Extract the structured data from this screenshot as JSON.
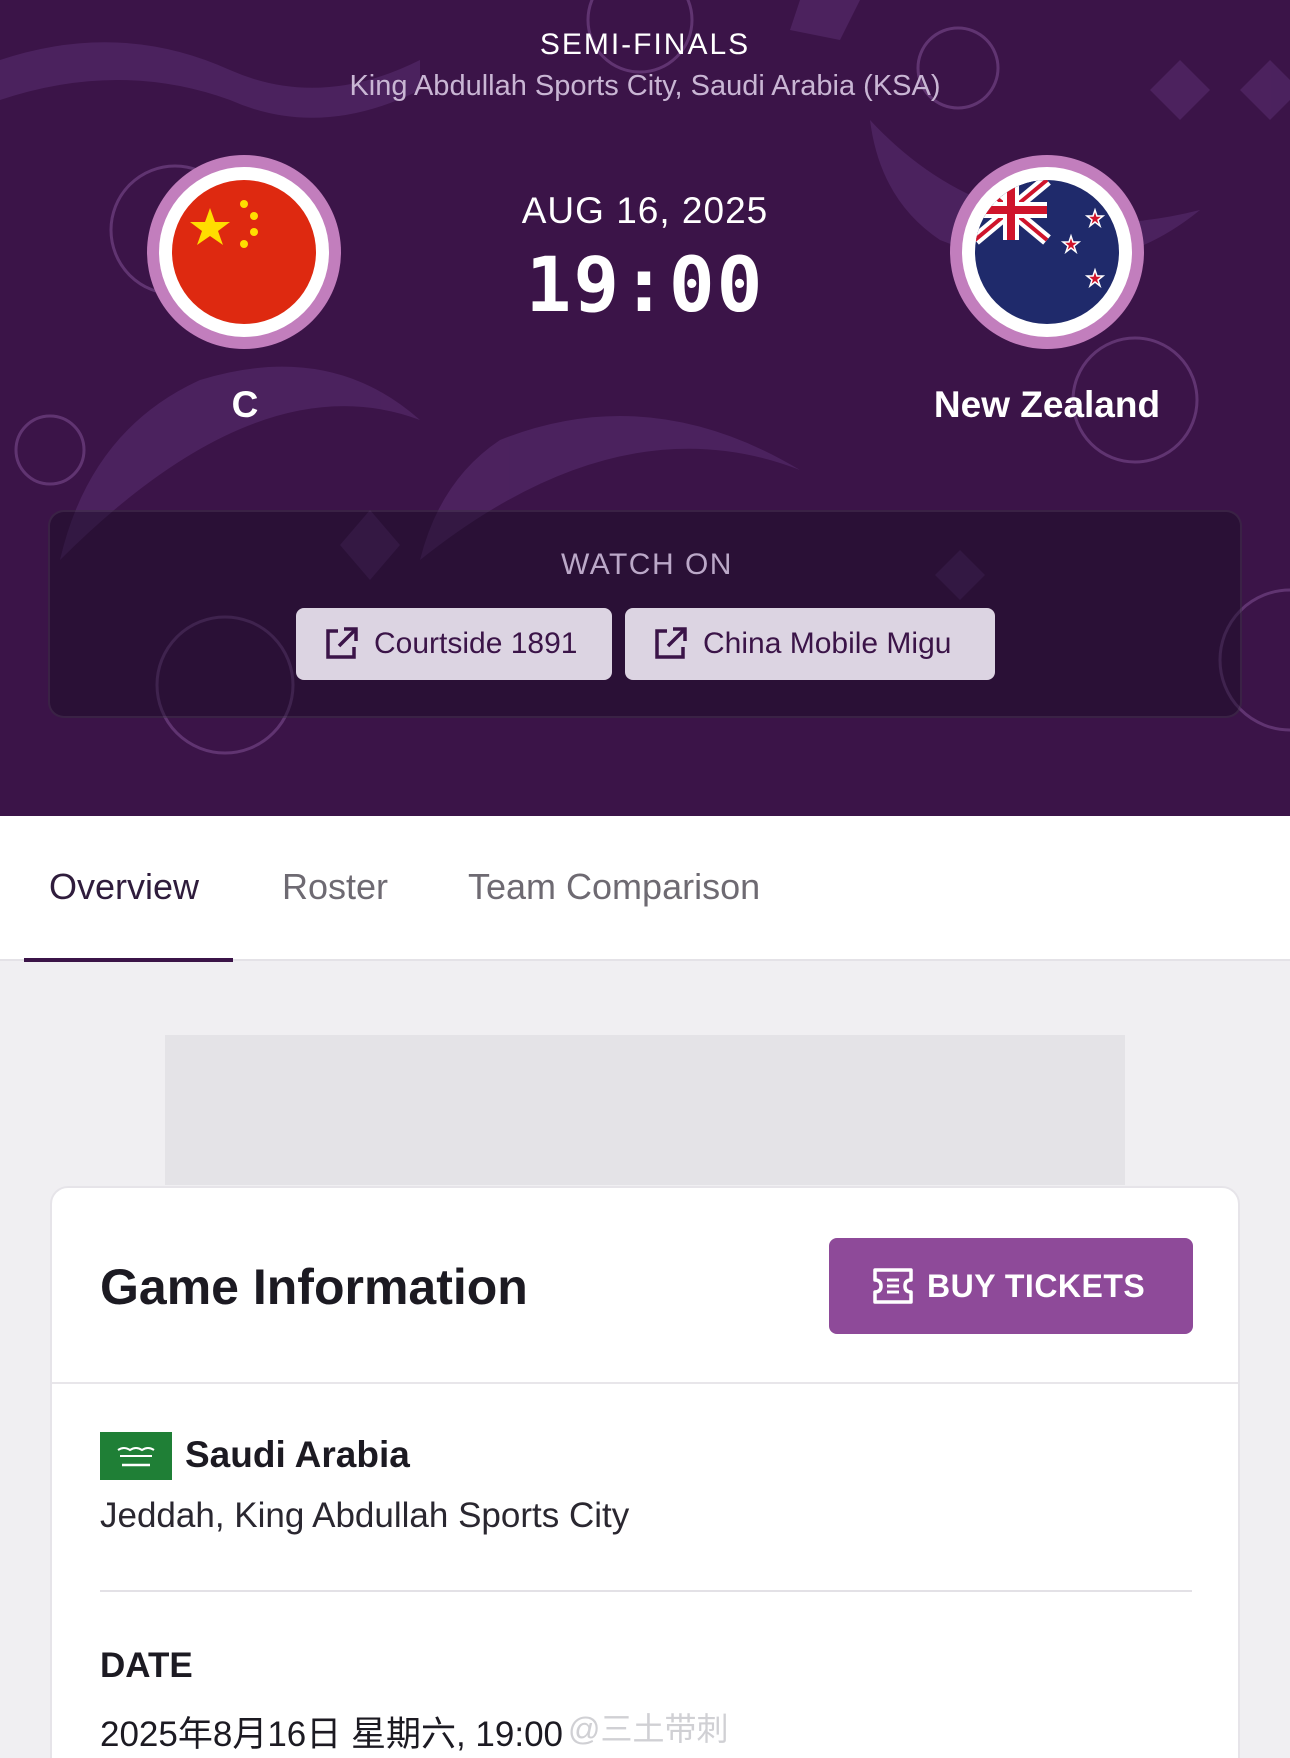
{
  "header": {
    "round": "SEMI-FINALS",
    "venue": "King Abdullah Sports City, Saudi Arabia (KSA)",
    "date": "AUG 16, 2025",
    "time": "19:00"
  },
  "teams": {
    "home": {
      "name": "C",
      "flag_icon": "china-flag-icon"
    },
    "away": {
      "name": "New Zealand",
      "flag_icon": "new-zealand-flag-icon"
    }
  },
  "watch_on": {
    "title": "WATCH ON",
    "providers": [
      {
        "label": "Courtside 1891",
        "icon": "external-link-icon"
      },
      {
        "label": "China Mobile Migu",
        "icon": "external-link-icon"
      }
    ]
  },
  "tabs": [
    {
      "label": "Overview",
      "active": true
    },
    {
      "label": "Roster",
      "active": false
    },
    {
      "label": "Team Comparison",
      "active": false
    }
  ],
  "game_info": {
    "title": "Game Information",
    "buy_tickets_label": "BUY TICKETS",
    "buy_tickets_icon": "ticket-icon",
    "country": "Saudi Arabia",
    "country_flag_icon": "saudi-arabia-flag-icon",
    "city": "Jeddah, King Abdullah Sports City",
    "date_label": "DATE",
    "date_value": "2025年8月16日 星期六, 19:00",
    "date_value_2": ""
  },
  "watermark": "@三土带刺",
  "colors": {
    "hero_bg": "#3b1448",
    "accent": "#8e4a99",
    "flag_ring": "#c27ebd",
    "stream_button_bg": "#dcd4e2"
  }
}
